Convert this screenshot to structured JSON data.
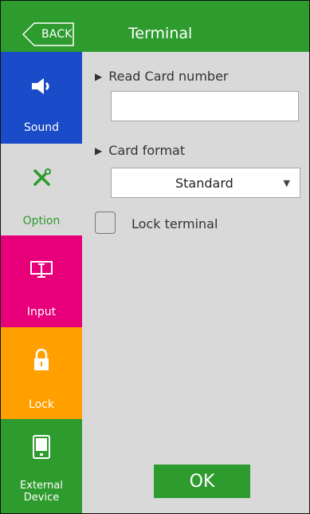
{
  "header": {
    "back_label": "BACK",
    "title": "Terminal",
    "color": "#2e9b2e"
  },
  "sidebar": {
    "items": [
      {
        "label": "Sound",
        "icon": "speaker-icon",
        "color": "#1a4bc8",
        "selected": false
      },
      {
        "label": "Option",
        "icon": "tools-icon",
        "color": "#d9d9d9",
        "selected": true
      },
      {
        "label": "Input",
        "icon": "monitor-icon",
        "color": "#e8007a",
        "selected": false
      },
      {
        "label": "Lock",
        "icon": "padlock-icon",
        "color": "#ffa000",
        "selected": false
      },
      {
        "label": "External",
        "label2": "Device",
        "icon": "device-icon",
        "color": "#2e9b2e",
        "selected": false
      }
    ]
  },
  "main": {
    "read_card_label": "Read Card number",
    "read_card_value": "",
    "card_format_label": "Card format",
    "card_format_value": "Standard",
    "lock_label": "Lock terminal",
    "lock_checked": false,
    "ok_label": "OK"
  }
}
